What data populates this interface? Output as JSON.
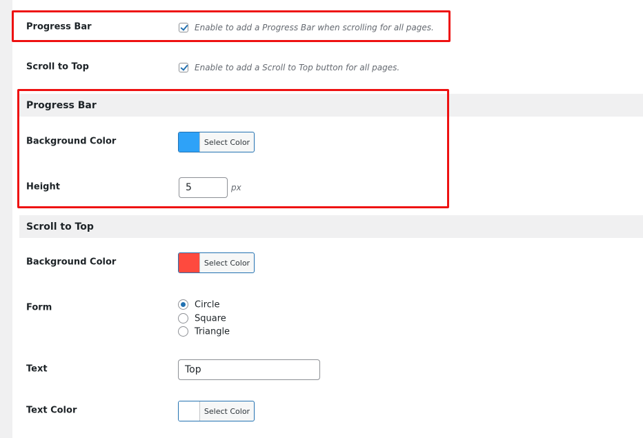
{
  "general": {
    "progress_bar": {
      "label": "Progress Bar",
      "checked": true,
      "description": "Enable to add a Progress Bar when scrolling for all pages."
    },
    "scroll_to_top": {
      "label": "Scroll to Top",
      "checked": true,
      "description": "Enable to add a Scroll to Top button for all pages."
    }
  },
  "progress_bar_section": {
    "title": "Progress Bar",
    "background_color": {
      "label": "Background Color",
      "button": "Select Color",
      "value": "#2ea2f8"
    },
    "height": {
      "label": "Height",
      "value": "5",
      "unit": "px"
    }
  },
  "scroll_to_top_section": {
    "title": "Scroll to Top",
    "background_color": {
      "label": "Background Color",
      "button": "Select Color",
      "value": "#fe4a3e"
    },
    "form": {
      "label": "Form",
      "options": [
        "Circle",
        "Square",
        "Triangle"
      ],
      "selected": "Circle"
    },
    "text": {
      "label": "Text",
      "value": "Top"
    },
    "text_color": {
      "label": "Text Color",
      "button": "Select Color",
      "value": "#ffffff"
    }
  },
  "highlight_color": "#ee1111"
}
